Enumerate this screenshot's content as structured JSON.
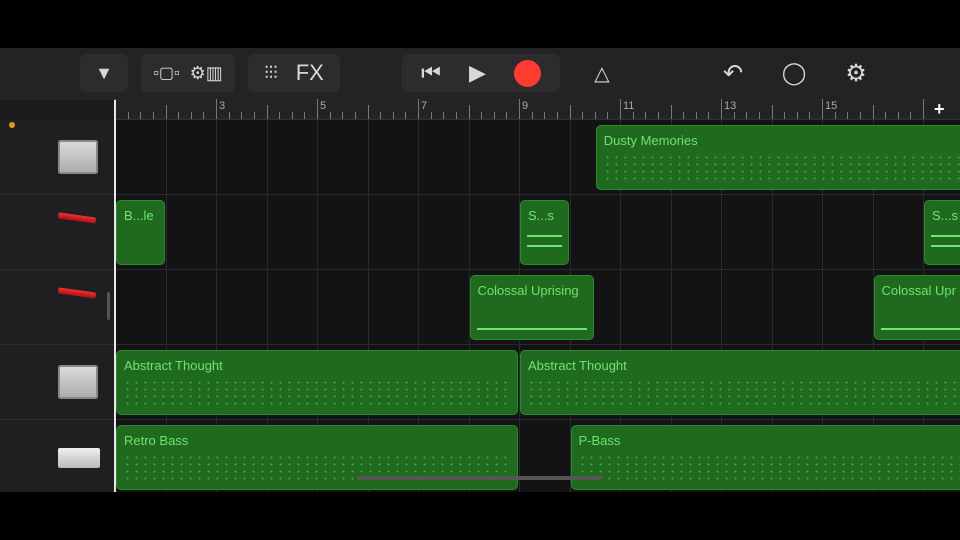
{
  "toolbar": {
    "browser_icon": "triangle-down-icon",
    "tracks_view_icon": "tracks-view-icon",
    "instrument_icon": "keyboard-gear-icon",
    "mixer_icon": "mixer-sliders-icon",
    "fx_label": "FX",
    "rewind_icon": "skip-back-icon",
    "play_icon": "play-icon",
    "record_icon": "record-icon",
    "metronome_icon": "metronome-icon",
    "undo_icon": "undo-icon",
    "loop_icon": "loop-browser-icon",
    "settings_icon": "settings-gear-icon",
    "record_color": "#ff3b30"
  },
  "ruler": {
    "bars": [
      "3",
      "5",
      "7",
      "9",
      "11",
      "13",
      "15"
    ],
    "add_label": "+"
  },
  "tracks": [
    {
      "instrument": "drum-machine",
      "regions": [
        {
          "name": "Dusty Memories",
          "start": 10.5,
          "length": 8,
          "style": "dots"
        }
      ]
    },
    {
      "instrument": "synth-keyboard",
      "regions": [
        {
          "name": "B...le",
          "start": 1,
          "length": 1,
          "style": "empty"
        },
        {
          "name": "S...s",
          "start": 9,
          "length": 1,
          "style": "lines"
        },
        {
          "name": "S...s",
          "start": 17,
          "length": 1,
          "style": "lines"
        }
      ]
    },
    {
      "instrument": "synth-keyboard",
      "regions": [
        {
          "name": "Colossal Uprising",
          "start": 8,
          "length": 2.5,
          "style": "line"
        },
        {
          "name": "Colossal Upr",
          "start": 16,
          "length": 3,
          "style": "line"
        }
      ]
    },
    {
      "instrument": "drum-machine",
      "regions": [
        {
          "name": "Abstract Thought",
          "start": 1,
          "length": 8,
          "style": "dots"
        },
        {
          "name": "Abstract Thought",
          "start": 9,
          "length": 9,
          "style": "dots"
        }
      ]
    },
    {
      "instrument": "bass-synth",
      "regions": [
        {
          "name": "Retro Bass",
          "start": 1,
          "length": 8,
          "style": "dots"
        },
        {
          "name": "P-Bass",
          "start": 10,
          "length": 8,
          "style": "dots"
        }
      ]
    }
  ]
}
